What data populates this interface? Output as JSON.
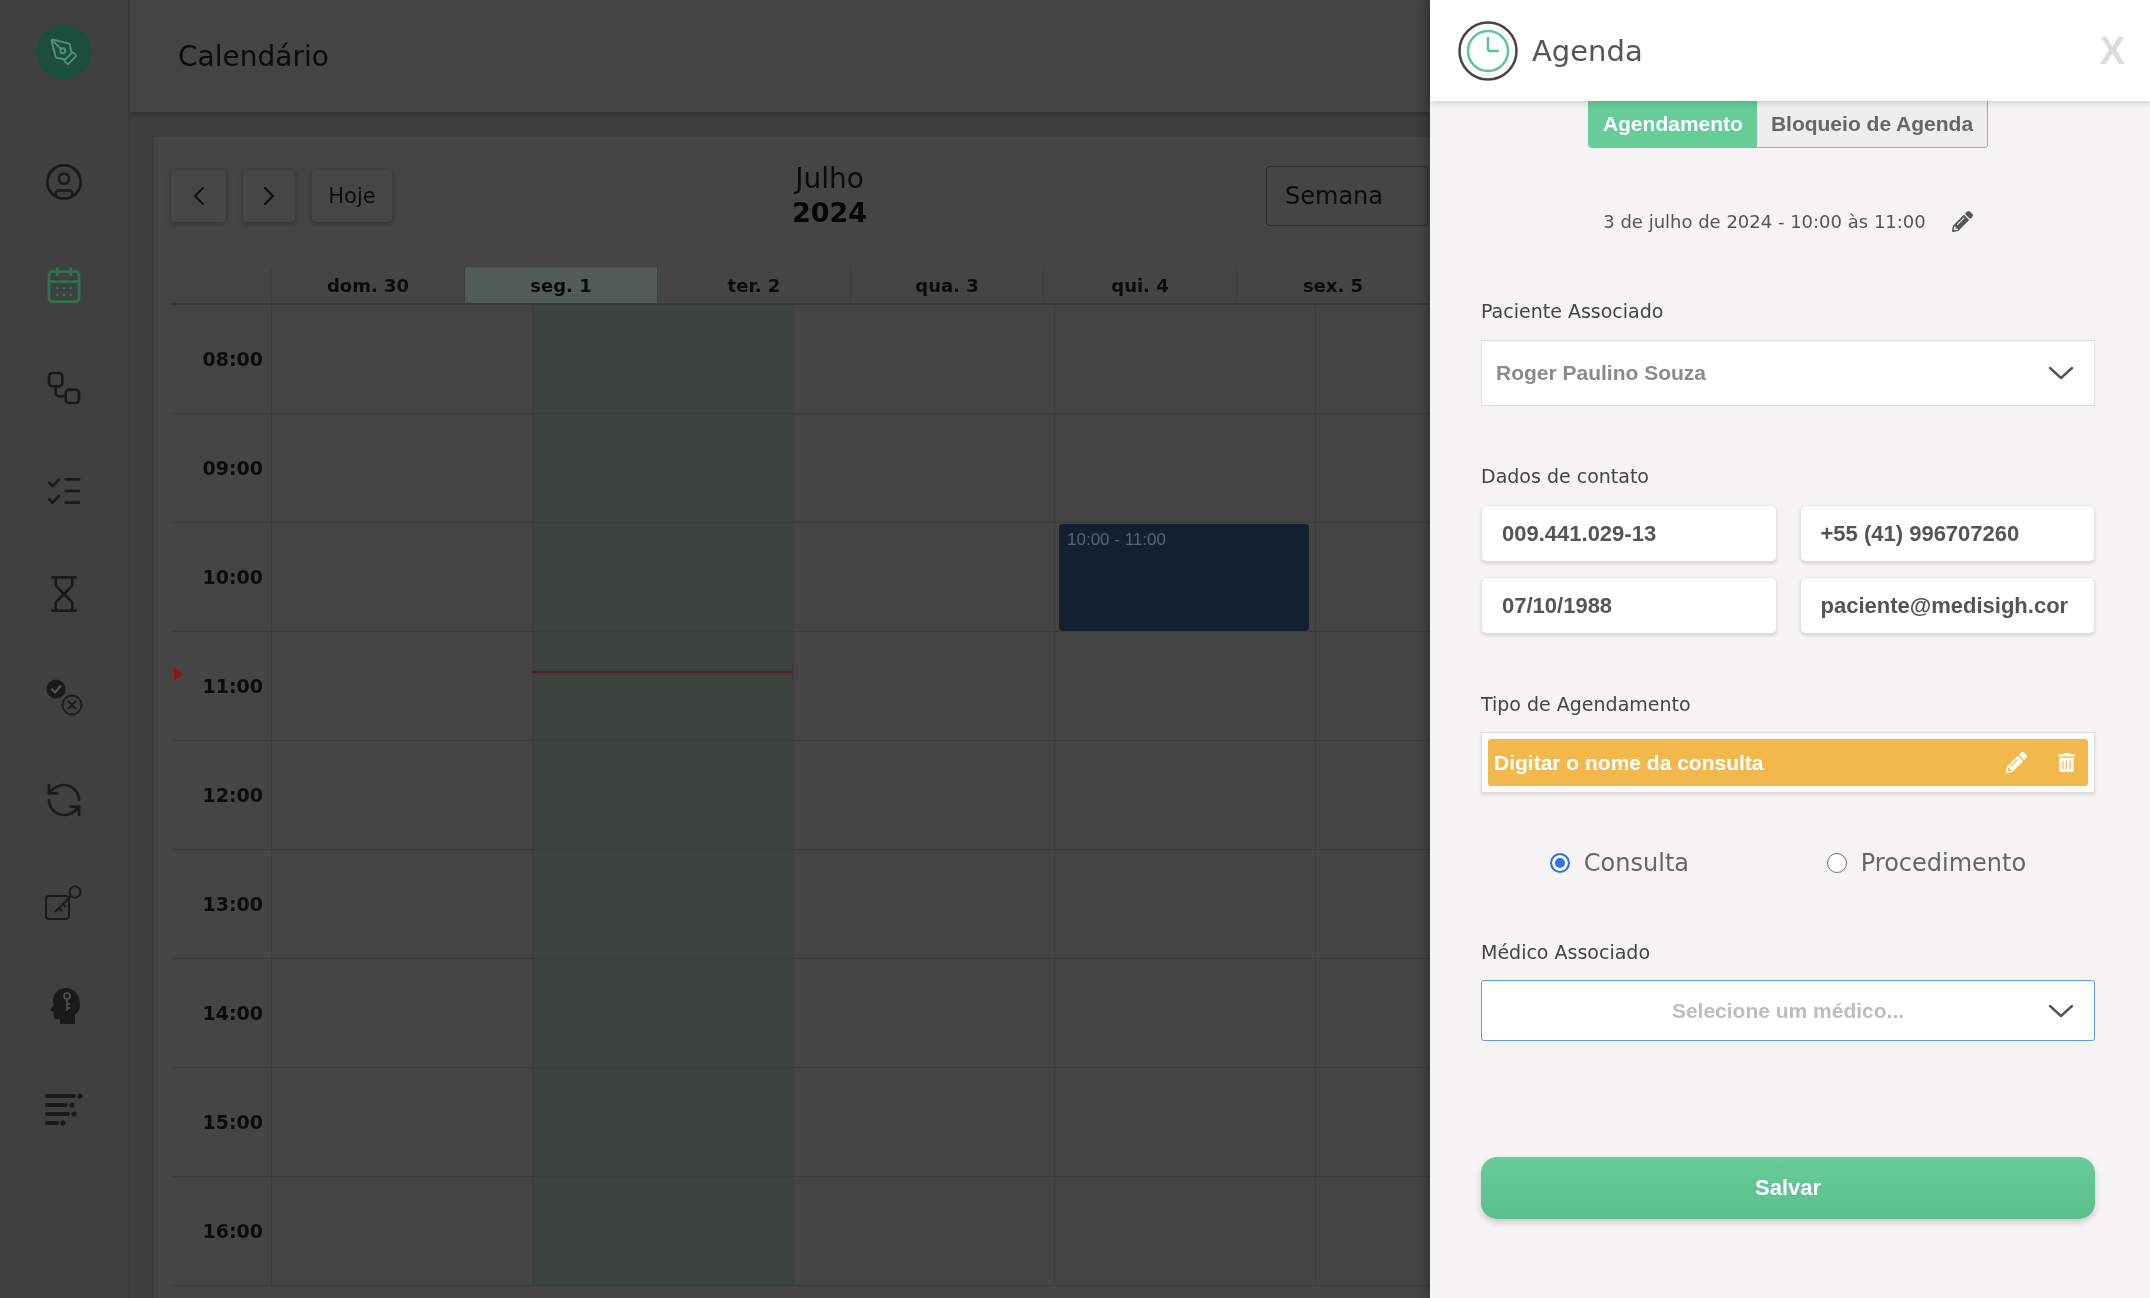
{
  "sidebar": {
    "items": [
      {
        "kind": "patients",
        "selected": false
      },
      {
        "kind": "calendar",
        "selected": true
      },
      {
        "kind": "pipeline",
        "selected": false
      },
      {
        "kind": "tasks",
        "selected": false
      },
      {
        "kind": "waiting",
        "selected": false
      },
      {
        "kind": "approvals",
        "selected": false
      },
      {
        "kind": "sync",
        "selected": false
      },
      {
        "kind": "access",
        "selected": false
      },
      {
        "kind": "mind",
        "selected": false
      },
      {
        "kind": "menu",
        "selected": false
      }
    ]
  },
  "header": {
    "title": "Calendário"
  },
  "calendar": {
    "today_button": "Hoje",
    "month": "Julho",
    "year": "2024",
    "view": "Semana",
    "days": [
      {
        "label": "dom. 30",
        "selected": false
      },
      {
        "label": "seg. 1",
        "selected": true
      },
      {
        "label": "ter. 2",
        "selected": false
      },
      {
        "label": "qua. 3",
        "selected": false,
        "events": [
          {
            "time": "10:00 - 11:00"
          }
        ]
      },
      {
        "label": "qui. 4",
        "selected": false
      },
      {
        "label": "sex. 5",
        "selected": false
      }
    ],
    "hours": [
      {
        "label": "08:00",
        "current_time": false
      },
      {
        "label": "09:00",
        "current_time": false
      },
      {
        "label": "10:00",
        "current_time": false
      },
      {
        "label": "11:00",
        "current_time": true
      },
      {
        "label": "12:00",
        "current_time": false
      },
      {
        "label": "13:00",
        "current_time": false
      },
      {
        "label": "14:00",
        "current_time": false
      },
      {
        "label": "15:00",
        "current_time": false
      },
      {
        "label": "16:00",
        "current_time": false
      }
    ]
  },
  "panel": {
    "title": "Agenda",
    "close": "X",
    "tabs": [
      {
        "label": "Agendamento",
        "selected": true
      },
      {
        "label": "Bloqueio de Agenda",
        "selected": false
      }
    ],
    "schedule": "3 de julho de 2024 - 10:00 às 11:00",
    "patient": {
      "label": "Paciente Associado",
      "value": "Roger Paulino Souza"
    },
    "contact": {
      "label": "Dados de contato",
      "values": [
        "009.441.029-13",
        "+55 (41) 996707260",
        "07/10/1988",
        "paciente@medisigh.cor"
      ]
    },
    "appointment_type": {
      "label": "Tipo de Agendamento",
      "value": "Digitar o nome da consulta"
    },
    "options": [
      {
        "label": "Consulta",
        "selected": true
      },
      {
        "label": "Procedimento",
        "selected": false
      }
    ],
    "doctor": {
      "label": "Médico Associado",
      "placeholder": "Selecione um médico..."
    },
    "save_button": "Salvar"
  }
}
